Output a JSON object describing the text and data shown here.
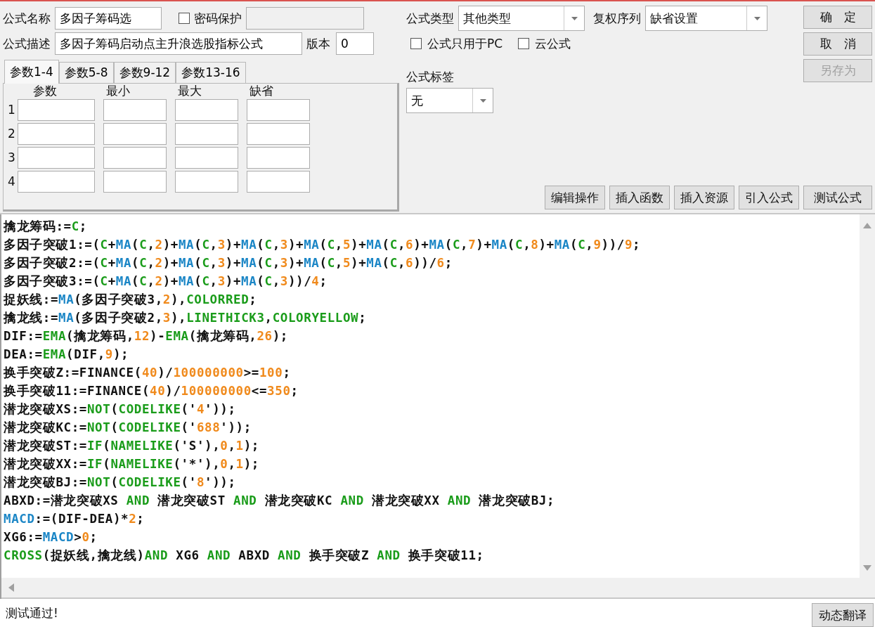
{
  "formula": {
    "name_label": "公式名称",
    "name_value": "多因子筹码选",
    "password": {
      "label": "密码保护",
      "checked": false
    },
    "desc_label": "公式描述",
    "desc_value": "多因子筹码启动点主升浪选股指标公式",
    "version_label": "版本",
    "version_value": "0"
  },
  "type": {
    "label": "公式类型",
    "value": "其他类型"
  },
  "rights": {
    "label": "复权序列",
    "value": "缺省设置"
  },
  "options": [
    {
      "label": "公式只用于PC",
      "checked": false
    },
    {
      "label": "云公式",
      "checked": false
    }
  ],
  "tag": {
    "label": "公式标签",
    "value": "无"
  },
  "side_buttons": [
    {
      "label": "确　定",
      "disabled": false
    },
    {
      "label": "取　消",
      "disabled": false
    },
    {
      "label": "另存为",
      "disabled": true
    }
  ],
  "tabs": [
    {
      "label": "参数1-4",
      "selected": true
    },
    {
      "label": "参数5-8",
      "selected": false
    },
    {
      "label": "参数9-12",
      "selected": false
    },
    {
      "label": "参数13-16",
      "selected": false
    }
  ],
  "param_columns": [
    "参数",
    "最小",
    "最大",
    "缺省"
  ],
  "param_rows": [
    "1",
    "2",
    "3",
    "4"
  ],
  "tool_buttons": [
    "编辑操作",
    "插入函数",
    "插入资源",
    "引入公式",
    "测试公式"
  ],
  "code_lines": [
    [
      {
        "kind": "text",
        "text": "擒龙筹码:="
      },
      {
        "kind": "keyword",
        "text": "C"
      },
      {
        "kind": "text",
        "text": ";"
      }
    ],
    [
      {
        "kind": "text",
        "text": "多因子突破1:=("
      },
      {
        "kind": "keyword",
        "text": "C"
      },
      {
        "kind": "text",
        "text": "+"
      },
      {
        "kind": "function",
        "text": "MA"
      },
      {
        "kind": "text",
        "text": "("
      },
      {
        "kind": "keyword",
        "text": "C"
      },
      {
        "kind": "text",
        "text": ","
      },
      {
        "kind": "number",
        "text": "2"
      },
      {
        "kind": "text",
        "text": ")+"
      },
      {
        "kind": "function",
        "text": "MA"
      },
      {
        "kind": "text",
        "text": "("
      },
      {
        "kind": "keyword",
        "text": "C"
      },
      {
        "kind": "text",
        "text": ","
      },
      {
        "kind": "number",
        "text": "3"
      },
      {
        "kind": "text",
        "text": ")+"
      },
      {
        "kind": "function",
        "text": "MA"
      },
      {
        "kind": "text",
        "text": "("
      },
      {
        "kind": "keyword",
        "text": "C"
      },
      {
        "kind": "text",
        "text": ","
      },
      {
        "kind": "number",
        "text": "3"
      },
      {
        "kind": "text",
        "text": ")+"
      },
      {
        "kind": "function",
        "text": "MA"
      },
      {
        "kind": "text",
        "text": "("
      },
      {
        "kind": "keyword",
        "text": "C"
      },
      {
        "kind": "text",
        "text": ","
      },
      {
        "kind": "number",
        "text": "5"
      },
      {
        "kind": "text",
        "text": ")+"
      },
      {
        "kind": "function",
        "text": "MA"
      },
      {
        "kind": "text",
        "text": "("
      },
      {
        "kind": "keyword",
        "text": "C"
      },
      {
        "kind": "text",
        "text": ","
      },
      {
        "kind": "number",
        "text": "6"
      },
      {
        "kind": "text",
        "text": ")+"
      },
      {
        "kind": "function",
        "text": "MA"
      },
      {
        "kind": "text",
        "text": "("
      },
      {
        "kind": "keyword",
        "text": "C"
      },
      {
        "kind": "text",
        "text": ","
      },
      {
        "kind": "number",
        "text": "7"
      },
      {
        "kind": "text",
        "text": ")+"
      },
      {
        "kind": "function",
        "text": "MA"
      },
      {
        "kind": "text",
        "text": "("
      },
      {
        "kind": "keyword",
        "text": "C"
      },
      {
        "kind": "text",
        "text": ","
      },
      {
        "kind": "number",
        "text": "8"
      },
      {
        "kind": "text",
        "text": ")+"
      },
      {
        "kind": "function",
        "text": "MA"
      },
      {
        "kind": "text",
        "text": "("
      },
      {
        "kind": "keyword",
        "text": "C"
      },
      {
        "kind": "text",
        "text": ","
      },
      {
        "kind": "number",
        "text": "9"
      },
      {
        "kind": "text",
        "text": "))/"
      },
      {
        "kind": "number",
        "text": "9"
      },
      {
        "kind": "text",
        "text": ";"
      }
    ],
    [
      {
        "kind": "text",
        "text": "多因子突破2:=("
      },
      {
        "kind": "keyword",
        "text": "C"
      },
      {
        "kind": "text",
        "text": "+"
      },
      {
        "kind": "function",
        "text": "MA"
      },
      {
        "kind": "text",
        "text": "("
      },
      {
        "kind": "keyword",
        "text": "C"
      },
      {
        "kind": "text",
        "text": ","
      },
      {
        "kind": "number",
        "text": "2"
      },
      {
        "kind": "text",
        "text": ")+"
      },
      {
        "kind": "function",
        "text": "MA"
      },
      {
        "kind": "text",
        "text": "("
      },
      {
        "kind": "keyword",
        "text": "C"
      },
      {
        "kind": "text",
        "text": ","
      },
      {
        "kind": "number",
        "text": "3"
      },
      {
        "kind": "text",
        "text": ")+"
      },
      {
        "kind": "function",
        "text": "MA"
      },
      {
        "kind": "text",
        "text": "("
      },
      {
        "kind": "keyword",
        "text": "C"
      },
      {
        "kind": "text",
        "text": ","
      },
      {
        "kind": "number",
        "text": "3"
      },
      {
        "kind": "text",
        "text": ")+"
      },
      {
        "kind": "function",
        "text": "MA"
      },
      {
        "kind": "text",
        "text": "("
      },
      {
        "kind": "keyword",
        "text": "C"
      },
      {
        "kind": "text",
        "text": ","
      },
      {
        "kind": "number",
        "text": "5"
      },
      {
        "kind": "text",
        "text": ")+"
      },
      {
        "kind": "function",
        "text": "MA"
      },
      {
        "kind": "text",
        "text": "("
      },
      {
        "kind": "keyword",
        "text": "C"
      },
      {
        "kind": "text",
        "text": ","
      },
      {
        "kind": "number",
        "text": "6"
      },
      {
        "kind": "text",
        "text": "))/"
      },
      {
        "kind": "number",
        "text": "6"
      },
      {
        "kind": "text",
        "text": ";"
      }
    ],
    [
      {
        "kind": "text",
        "text": "多因子突破3:=("
      },
      {
        "kind": "keyword",
        "text": "C"
      },
      {
        "kind": "text",
        "text": "+"
      },
      {
        "kind": "function",
        "text": "MA"
      },
      {
        "kind": "text",
        "text": "("
      },
      {
        "kind": "keyword",
        "text": "C"
      },
      {
        "kind": "text",
        "text": ","
      },
      {
        "kind": "number",
        "text": "2"
      },
      {
        "kind": "text",
        "text": ")+"
      },
      {
        "kind": "function",
        "text": "MA"
      },
      {
        "kind": "text",
        "text": "("
      },
      {
        "kind": "keyword",
        "text": "C"
      },
      {
        "kind": "text",
        "text": ","
      },
      {
        "kind": "number",
        "text": "3"
      },
      {
        "kind": "text",
        "text": ")+"
      },
      {
        "kind": "function",
        "text": "MA"
      },
      {
        "kind": "text",
        "text": "("
      },
      {
        "kind": "keyword",
        "text": "C"
      },
      {
        "kind": "text",
        "text": ","
      },
      {
        "kind": "number",
        "text": "3"
      },
      {
        "kind": "text",
        "text": "))/"
      },
      {
        "kind": "number",
        "text": "4"
      },
      {
        "kind": "text",
        "text": ";"
      }
    ],
    [
      {
        "kind": "text",
        "text": "捉妖线:="
      },
      {
        "kind": "function",
        "text": "MA"
      },
      {
        "kind": "text",
        "text": "(多因子突破3,"
      },
      {
        "kind": "number",
        "text": "2"
      },
      {
        "kind": "text",
        "text": "),"
      },
      {
        "kind": "keyword",
        "text": "COLORRED"
      },
      {
        "kind": "text",
        "text": ";"
      }
    ],
    [
      {
        "kind": "text",
        "text": "擒龙线:="
      },
      {
        "kind": "function",
        "text": "MA"
      },
      {
        "kind": "text",
        "text": "(多因子突破2,"
      },
      {
        "kind": "number",
        "text": "3"
      },
      {
        "kind": "text",
        "text": "),"
      },
      {
        "kind": "keyword",
        "text": "LINETHICK3"
      },
      {
        "kind": "text",
        "text": ","
      },
      {
        "kind": "keyword",
        "text": "COLORYELLOW"
      },
      {
        "kind": "text",
        "text": ";"
      }
    ],
    [
      {
        "kind": "text",
        "text": "DIF:="
      },
      {
        "kind": "keyword",
        "text": "EMA"
      },
      {
        "kind": "text",
        "text": "(擒龙筹码,"
      },
      {
        "kind": "number",
        "text": "12"
      },
      {
        "kind": "text",
        "text": ")-"
      },
      {
        "kind": "keyword",
        "text": "EMA"
      },
      {
        "kind": "text",
        "text": "(擒龙筹码,"
      },
      {
        "kind": "number",
        "text": "26"
      },
      {
        "kind": "text",
        "text": ");"
      }
    ],
    [
      {
        "kind": "text",
        "text": "DEA:="
      },
      {
        "kind": "keyword",
        "text": "EMA"
      },
      {
        "kind": "text",
        "text": "(DIF,"
      },
      {
        "kind": "number",
        "text": "9"
      },
      {
        "kind": "text",
        "text": ");"
      }
    ],
    [
      {
        "kind": "text",
        "text": "换手突破Z:=FINANCE("
      },
      {
        "kind": "number",
        "text": "40"
      },
      {
        "kind": "text",
        "text": ")/"
      },
      {
        "kind": "number",
        "text": "100000000"
      },
      {
        "kind": "text",
        "text": ">="
      },
      {
        "kind": "number",
        "text": "100"
      },
      {
        "kind": "text",
        "text": ";"
      }
    ],
    [
      {
        "kind": "text",
        "text": "换手突破11:=FINANCE("
      },
      {
        "kind": "number",
        "text": "40"
      },
      {
        "kind": "text",
        "text": ")/"
      },
      {
        "kind": "number",
        "text": "100000000"
      },
      {
        "kind": "text",
        "text": "<="
      },
      {
        "kind": "number",
        "text": "350"
      },
      {
        "kind": "text",
        "text": ";"
      }
    ],
    [
      {
        "kind": "text",
        "text": "潜龙突破XS:="
      },
      {
        "kind": "keyword",
        "text": "NOT"
      },
      {
        "kind": "text",
        "text": "("
      },
      {
        "kind": "keyword",
        "text": "CODELIKE"
      },
      {
        "kind": "text",
        "text": "('"
      },
      {
        "kind": "number",
        "text": "4"
      },
      {
        "kind": "text",
        "text": "'));"
      }
    ],
    [
      {
        "kind": "text",
        "text": "潜龙突破KC:="
      },
      {
        "kind": "keyword",
        "text": "NOT"
      },
      {
        "kind": "text",
        "text": "("
      },
      {
        "kind": "keyword",
        "text": "CODELIKE"
      },
      {
        "kind": "text",
        "text": "('"
      },
      {
        "kind": "number",
        "text": "688"
      },
      {
        "kind": "text",
        "text": "'));"
      }
    ],
    [
      {
        "kind": "text",
        "text": "潜龙突破ST:="
      },
      {
        "kind": "keyword",
        "text": "IF"
      },
      {
        "kind": "text",
        "text": "("
      },
      {
        "kind": "keyword",
        "text": "NAMELIKE"
      },
      {
        "kind": "text",
        "text": "('S'),"
      },
      {
        "kind": "number",
        "text": "0"
      },
      {
        "kind": "text",
        "text": ","
      },
      {
        "kind": "number",
        "text": "1"
      },
      {
        "kind": "text",
        "text": ");"
      }
    ],
    [
      {
        "kind": "text",
        "text": "潜龙突破XX:="
      },
      {
        "kind": "keyword",
        "text": "IF"
      },
      {
        "kind": "text",
        "text": "("
      },
      {
        "kind": "keyword",
        "text": "NAMELIKE"
      },
      {
        "kind": "text",
        "text": "('*'),"
      },
      {
        "kind": "number",
        "text": "0"
      },
      {
        "kind": "text",
        "text": ","
      },
      {
        "kind": "number",
        "text": "1"
      },
      {
        "kind": "text",
        "text": ");"
      }
    ],
    [
      {
        "kind": "text",
        "text": "潜龙突破BJ:="
      },
      {
        "kind": "keyword",
        "text": "NOT"
      },
      {
        "kind": "text",
        "text": "("
      },
      {
        "kind": "keyword",
        "text": "CODELIKE"
      },
      {
        "kind": "text",
        "text": "('"
      },
      {
        "kind": "number",
        "text": "8"
      },
      {
        "kind": "text",
        "text": "'));"
      }
    ],
    [
      {
        "kind": "text",
        "text": "ABXD:=潜龙突破XS "
      },
      {
        "kind": "keyword",
        "text": "AND"
      },
      {
        "kind": "text",
        "text": " 潜龙突破ST "
      },
      {
        "kind": "keyword",
        "text": "AND"
      },
      {
        "kind": "text",
        "text": " 潜龙突破KC "
      },
      {
        "kind": "keyword",
        "text": "AND"
      },
      {
        "kind": "text",
        "text": " 潜龙突破XX "
      },
      {
        "kind": "keyword",
        "text": "AND"
      },
      {
        "kind": "text",
        "text": " 潜龙突破BJ;"
      }
    ],
    [
      {
        "kind": "function",
        "text": "MACD"
      },
      {
        "kind": "text",
        "text": ":=(DIF-DEA)*"
      },
      {
        "kind": "number",
        "text": "2"
      },
      {
        "kind": "text",
        "text": ";"
      }
    ],
    [
      {
        "kind": "text",
        "text": "XG6:="
      },
      {
        "kind": "function",
        "text": "MACD"
      },
      {
        "kind": "text",
        "text": ">"
      },
      {
        "kind": "number",
        "text": "0"
      },
      {
        "kind": "text",
        "text": ";"
      }
    ],
    [
      {
        "kind": "keyword",
        "text": "CROSS"
      },
      {
        "kind": "text",
        "text": "(捉妖线,擒龙线)"
      },
      {
        "kind": "keyword",
        "text": "AND"
      },
      {
        "kind": "text",
        "text": " XG6 "
      },
      {
        "kind": "keyword",
        "text": "AND"
      },
      {
        "kind": "text",
        "text": " ABXD "
      },
      {
        "kind": "keyword",
        "text": "AND"
      },
      {
        "kind": "text",
        "text": " 换手突破Z "
      },
      {
        "kind": "keyword",
        "text": "AND"
      },
      {
        "kind": "text",
        "text": " 换手突破11;"
      }
    ]
  ],
  "status": {
    "message": "测试通过!",
    "button": "动态翻译"
  }
}
